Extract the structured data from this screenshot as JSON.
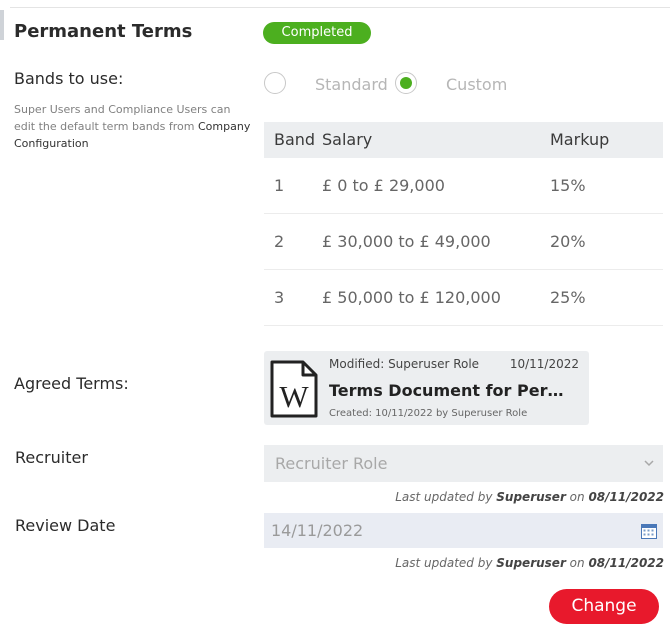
{
  "section": {
    "title": "Permanent Terms",
    "status_badge": "Completed"
  },
  "bands_to_use": {
    "label": "Bands to use:",
    "options": [
      "Standard",
      "Custom"
    ],
    "selected": "Custom",
    "hint": "Super Users and Compliance Users can edit the default term bands from ",
    "hint_link": "Company Configuration"
  },
  "bands_table": {
    "headers": [
      "Band",
      "Salary",
      "Markup"
    ],
    "rows": [
      {
        "band": "1",
        "salary": "£ 0 to £ 29,000",
        "markup": "15%"
      },
      {
        "band": "2",
        "salary": "£ 30,000 to £ 49,000",
        "markup": "20%"
      },
      {
        "band": "3",
        "salary": "£ 50,000 to £ 120,000",
        "markup": "25%"
      }
    ]
  },
  "agreed_terms": {
    "label": "Agreed Terms:",
    "document": {
      "icon": "word-document-icon",
      "modified": "Modified: Superuser Role",
      "modified_date": "10/11/2022",
      "name": "Terms Document for Permanent Placements",
      "created": "Created: 10/11/2022 by Superuser Role"
    }
  },
  "recruiter": {
    "label": "Recruiter",
    "value": "Recruiter Role",
    "updated_prefix": "Last updated by ",
    "updated_by": "Superuser",
    "updated_on": " on ",
    "updated_date": "08/11/2022"
  },
  "review_date": {
    "label": "Review Date",
    "value": "14/11/2022",
    "updated_prefix": "Last updated by ",
    "updated_by": "Superuser",
    "updated_on": " on ",
    "updated_date": "08/11/2022"
  },
  "actions": {
    "change_label": "Change"
  },
  "colors": {
    "accent_green": "#4caf1f",
    "change_red": "#e8192c",
    "panel_gray": "#eceef0"
  }
}
